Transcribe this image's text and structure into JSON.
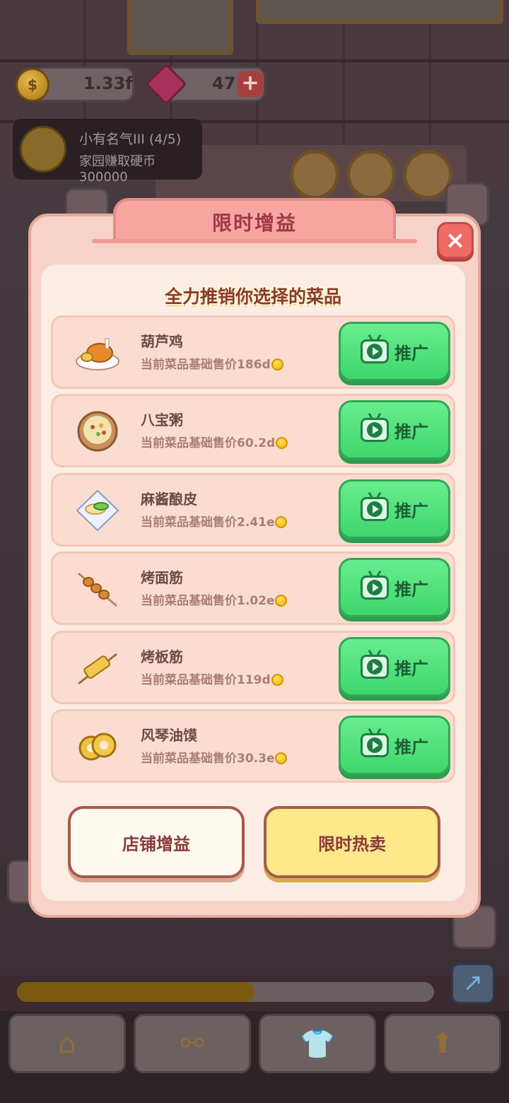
{
  "hud": {
    "coins": "1.33f",
    "gems": "47",
    "plus_label": "+",
    "fame_title": "小有名气III (4/5)",
    "fame_subtitle": "家园赚取硬币300000"
  },
  "modal": {
    "title": "限时增益",
    "close_label": "×",
    "subtitle": "全力推销你选择的菜品",
    "promote_label": "推广",
    "dishes": [
      {
        "name": "葫芦鸡",
        "price_text": "当前菜品基础售价186d",
        "icon": "roast-chicken-icon"
      },
      {
        "name": "八宝粥",
        "price_text": "当前菜品基础售价60.2d",
        "icon": "congee-bowl-icon"
      },
      {
        "name": "麻酱酿皮",
        "price_text": "当前菜品基础售价2.41e",
        "icon": "cold-noodle-icon"
      },
      {
        "name": "烤面筋",
        "price_text": "当前菜品基础售价1.02e",
        "icon": "gluten-skewer-icon"
      },
      {
        "name": "烤板筋",
        "price_text": "当前菜品基础售价119d",
        "icon": "grilled-tendon-icon"
      },
      {
        "name": "风琴油馍",
        "price_text": "当前菜品基础售价30.3e",
        "icon": "fried-bun-icon"
      }
    ],
    "footer": {
      "shop_buff_label": "店铺增益",
      "hot_sale_label": "限时热卖"
    }
  },
  "bottom": {
    "progress_fraction": 0.57,
    "nav": [
      {
        "name": "home",
        "icon": "house-icon"
      },
      {
        "name": "bone",
        "icon": "bone-icon"
      },
      {
        "name": "shirt",
        "icon": "shirt-icon"
      },
      {
        "name": "upgrade",
        "icon": "up-arrow-icon"
      }
    ]
  },
  "colors": {
    "promo_green": "#4fe07a",
    "modal_pink": "#f7d2c6",
    "title_red": "#a03848",
    "hot_sale_yellow": "#ffe88a"
  }
}
